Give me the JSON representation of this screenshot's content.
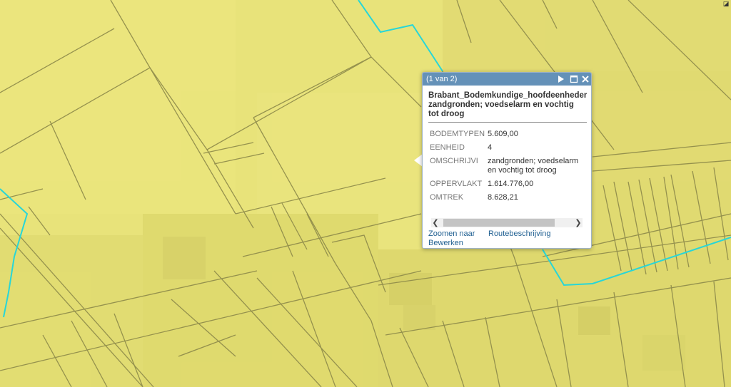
{
  "map": {
    "fill_color": "#e8e37a",
    "line_color": "#8d8a4a",
    "boundary_color": "#27d6d8"
  },
  "corner_icon": "resize-icon",
  "popup": {
    "counter": "(1 van 2)",
    "header_color": "#6491b8",
    "icons": [
      "next-feature-icon",
      "maximize-icon",
      "close-icon"
    ],
    "title_line1": "Brabant_Bodemkundige_hoofdeenheden:",
    "title_line2": "zandgronden; voedselarm en vochtig",
    "title_line3": "tot droog",
    "attributes": [
      {
        "key": "BODEMTYPEN",
        "value": "5.609,00"
      },
      {
        "key": "EENHEID",
        "value": "4"
      },
      {
        "key": "OMSCHRIJVI",
        "value": "zandgronden; voedselarm en vochtig tot droog"
      },
      {
        "key": "OPPERVLAKT",
        "value": "1.614.776,00"
      },
      {
        "key": "OMTREK",
        "value": "8.628,21"
      }
    ],
    "actions": {
      "zoom": "Zoomen naar",
      "route": "Routebeschrijving",
      "edit": "Bewerken"
    }
  }
}
